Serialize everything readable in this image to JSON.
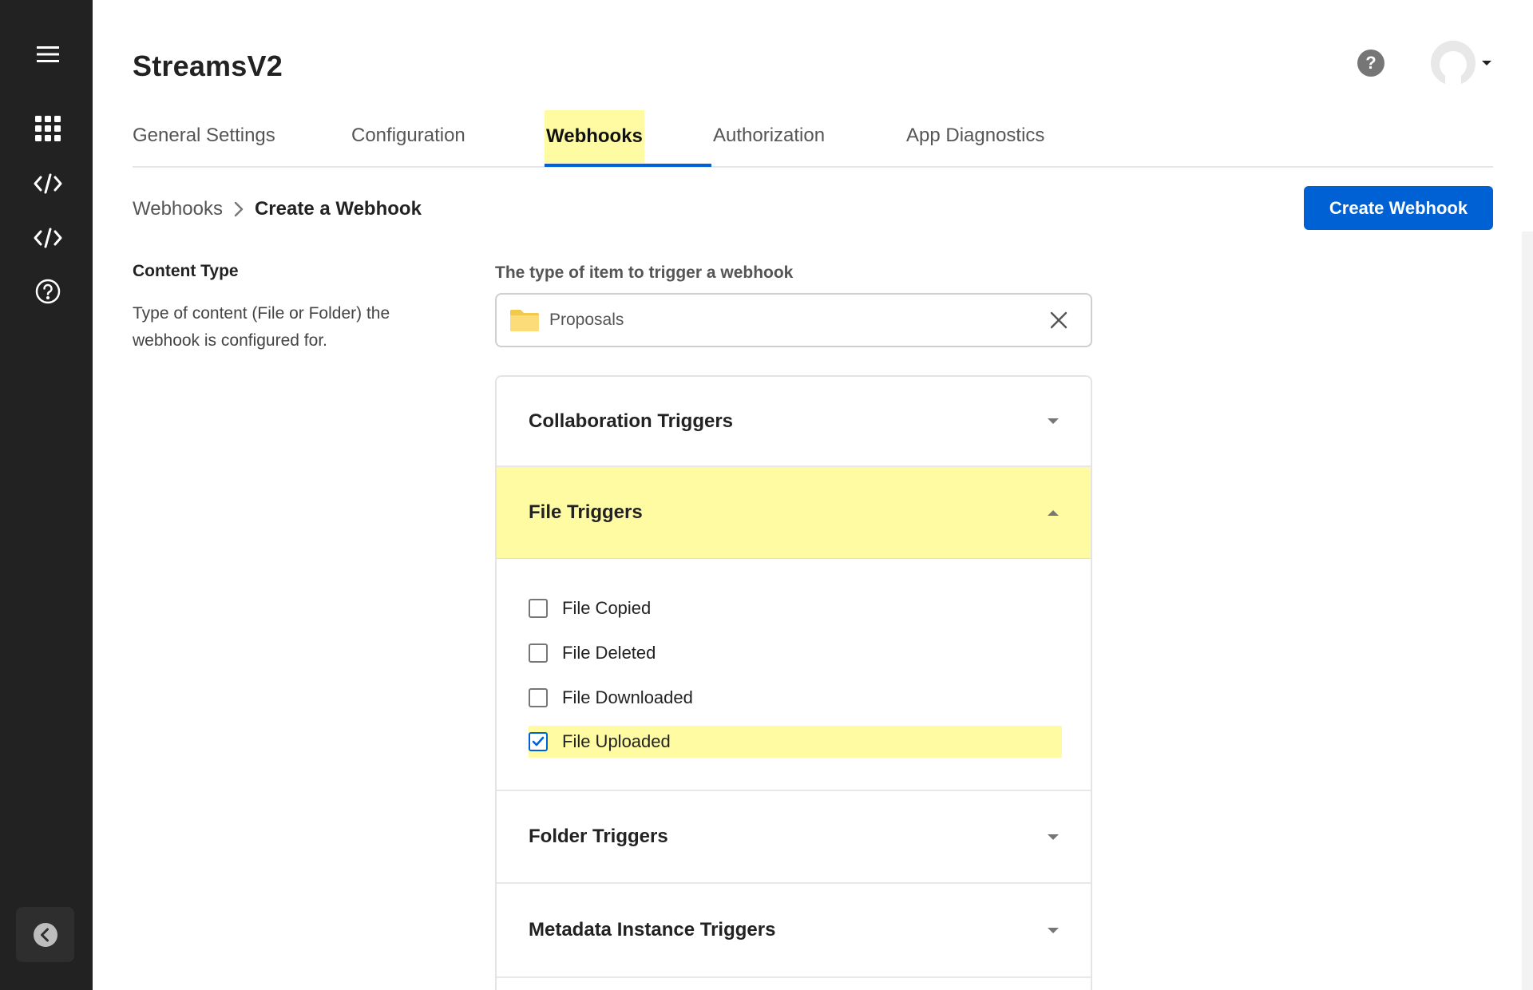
{
  "app": {
    "title": "StreamsV2"
  },
  "header": {
    "help_symbol": "?"
  },
  "sidebar": {
    "items": [
      {
        "icon": "hamburger-menu-icon"
      },
      {
        "icon": "apps-grid-icon"
      },
      {
        "icon": "code-icon"
      },
      {
        "icon": "code-icon"
      },
      {
        "icon": "help-circle-icon"
      }
    ],
    "collapse_icon": "chevron-left-icon"
  },
  "tabs": [
    {
      "label": "General Settings",
      "active": false
    },
    {
      "label": "Configuration",
      "active": false
    },
    {
      "label": "Webhooks",
      "active": true
    },
    {
      "label": "Authorization",
      "active": false
    },
    {
      "label": "App Diagnostics",
      "active": false
    }
  ],
  "breadcrumb": {
    "parent": "Webhooks",
    "current": "Create a Webhook"
  },
  "actions": {
    "create_label": "Create Webhook"
  },
  "content_type": {
    "title": "Content Type",
    "description": "Type of content (File or Folder) the webhook is configured for.",
    "field_label": "The type of item to trigger a webhook",
    "field_value": "Proposals"
  },
  "triggers": {
    "collaboration": {
      "title": "Collaboration Triggers",
      "expanded": false
    },
    "file": {
      "title": "File Triggers",
      "expanded": true,
      "options": [
        {
          "label": "File Copied",
          "checked": false
        },
        {
          "label": "File Deleted",
          "checked": false
        },
        {
          "label": "File Downloaded",
          "checked": false
        },
        {
          "label": "File Uploaded",
          "checked": true
        }
      ]
    },
    "folder": {
      "title": "Folder Triggers",
      "expanded": false
    },
    "metadata": {
      "title": "Metadata Instance Triggers",
      "expanded": false
    }
  },
  "colors": {
    "sidebar_bg": "#222222",
    "accent": "#0061d5",
    "highlight": "#fffba3",
    "folder": "#f7d360"
  }
}
